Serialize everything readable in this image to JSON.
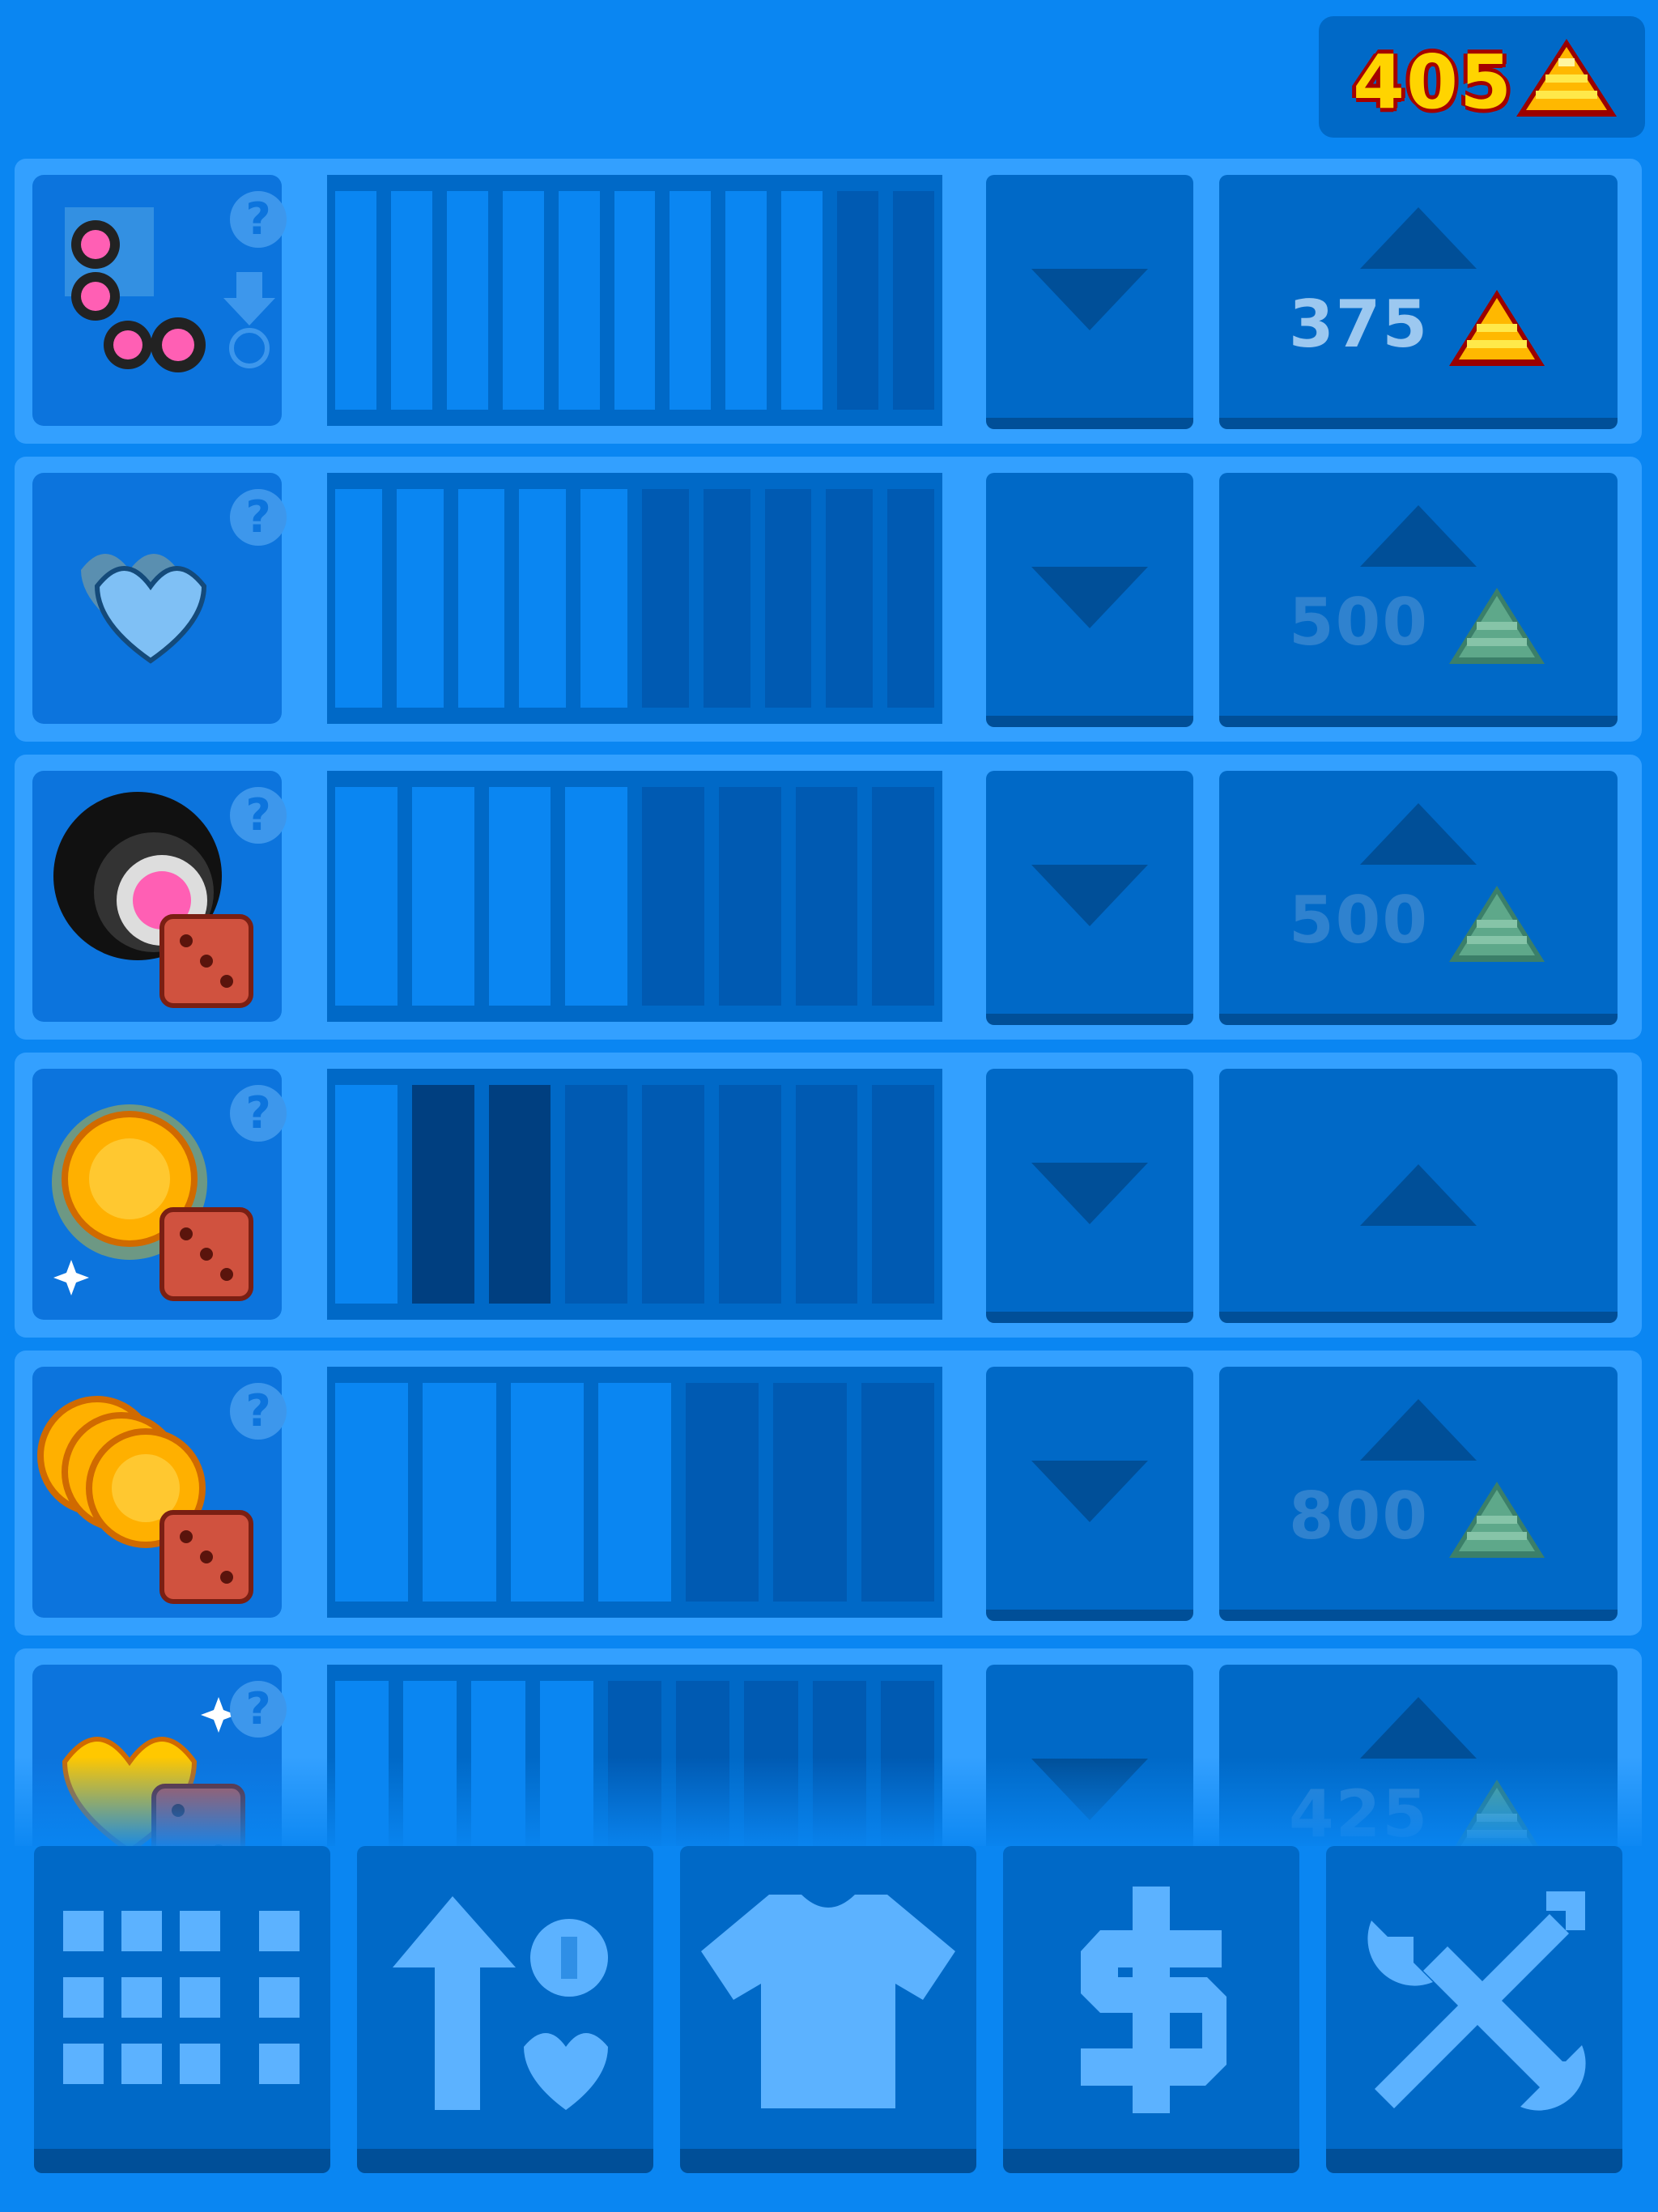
{
  "header": {
    "currency_amount": "405",
    "currency_icon": "gold-pile-icon"
  },
  "colors": {
    "bar_on": "#0a86f2",
    "bar_off": "#005ab2",
    "bar_dark": "#003f80"
  },
  "upgrades": [
    {
      "icon": "chained-sushi-rolls-icon",
      "level": 9,
      "max": 11,
      "price": "375",
      "affordable": true,
      "extra_dark": []
    },
    {
      "icon": "stacked-hearts-icon",
      "level": 5,
      "max": 10,
      "price": "500",
      "affordable": false,
      "extra_dark": []
    },
    {
      "icon": "sushi-roll-dice-icon",
      "level": 4,
      "max": 8,
      "price": "500",
      "affordable": false,
      "extra_dark": []
    },
    {
      "icon": "gold-coin-dice-icon",
      "level": 1,
      "max": 8,
      "price": "",
      "affordable": false,
      "extra_dark": [
        1,
        2
      ]
    },
    {
      "icon": "coin-stack-dice-icon",
      "level": 4,
      "max": 7,
      "price": "800",
      "affordable": false,
      "extra_dark": []
    },
    {
      "icon": "golden-heart-dice-icon",
      "level": 4,
      "max": 9,
      "price": "425",
      "affordable": false,
      "extra_dark": []
    }
  ],
  "nav": [
    {
      "name": "grid-menu",
      "icon": "grid-icon"
    },
    {
      "name": "upgrades",
      "icon": "arrow-up-heart-icon"
    },
    {
      "name": "skins",
      "icon": "shirt-icon"
    },
    {
      "name": "shop",
      "icon": "dollar-icon"
    },
    {
      "name": "settings",
      "icon": "tools-icon"
    }
  ]
}
